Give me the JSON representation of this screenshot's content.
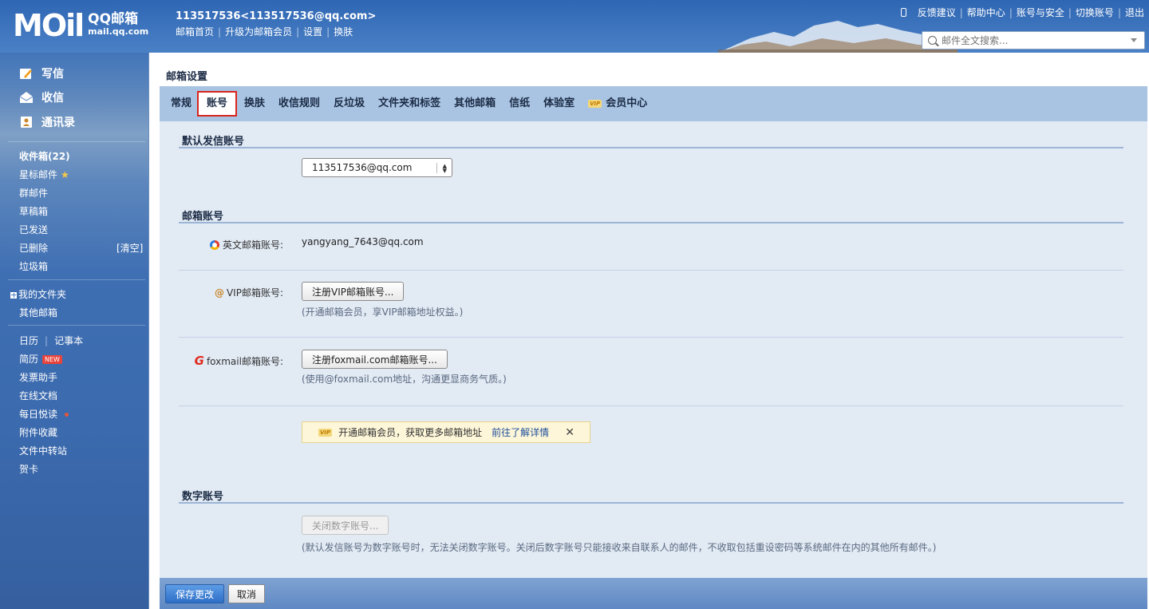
{
  "header": {
    "logo_big": "MOil",
    "logo_title": "QQ邮箱",
    "logo_sub": "mail.qq.com",
    "account": "113517536<113517536@qq.com>",
    "links": [
      "邮箱首页",
      "升级为邮箱会员",
      "设置",
      "换肤"
    ],
    "top_links": [
      "反馈建议",
      "帮助中心",
      "账号与安全",
      "切换账号",
      "退出"
    ],
    "search_placeholder": "邮件全文搜索..."
  },
  "sidebar": {
    "compose": "写信",
    "receive": "收信",
    "contacts": "通讯录",
    "folders": [
      "收件箱(22)",
      "星标邮件",
      "群邮件",
      "草稿箱",
      "已发送",
      "已删除",
      "垃圾箱"
    ],
    "clear": "[清空]",
    "my_folders": "我的文件夹",
    "other_mail": "其他邮箱",
    "calendar": "日历",
    "notebook": "记事本",
    "tools": [
      "简历",
      "发票助手",
      "在线文档",
      "每日悦读",
      "附件收藏",
      "文件中转站",
      "贺卡"
    ],
    "new_badge": "NEW"
  },
  "main": {
    "title": "邮箱设置",
    "tabs": [
      "常规",
      "账号",
      "换肤",
      "收信规则",
      "反垃圾",
      "文件夹和标签",
      "其他邮箱",
      "信纸",
      "体验室",
      "会员中心"
    ],
    "vip_badge": "VIP",
    "sections": {
      "default_sender": {
        "title": "默认发信账号",
        "selected": "113517536@qq.com"
      },
      "mail_accounts": {
        "title": "邮箱账号",
        "english_label": "英文邮箱账号:",
        "english_value": "yangyang_7643@qq.com",
        "vip_label": "VIP邮箱账号:",
        "vip_button": "注册VIP邮箱账号...",
        "vip_hint": "(开通邮箱会员，享VIP邮箱地址权益。)",
        "foxmail_label": "foxmail邮箱账号:",
        "foxmail_button": "注册foxmail.com邮箱账号...",
        "foxmail_hint": "(使用@foxmail.com地址，沟通更显商务气质。)",
        "banner_text": "开通邮箱会员，获取更多邮箱地址",
        "banner_link": "前往了解详情",
        "banner_close": "✕"
      },
      "digital": {
        "title": "数字账号",
        "button": "关闭数字账号...",
        "hint": "(默认发信账号为数字账号时，无法关闭数字账号。关闭后数字账号只能接收来自联系人的邮件，不收取包括重设密码等系统邮件在内的其他所有邮件。)"
      }
    },
    "save": "保存更改",
    "cancel": "取消"
  }
}
